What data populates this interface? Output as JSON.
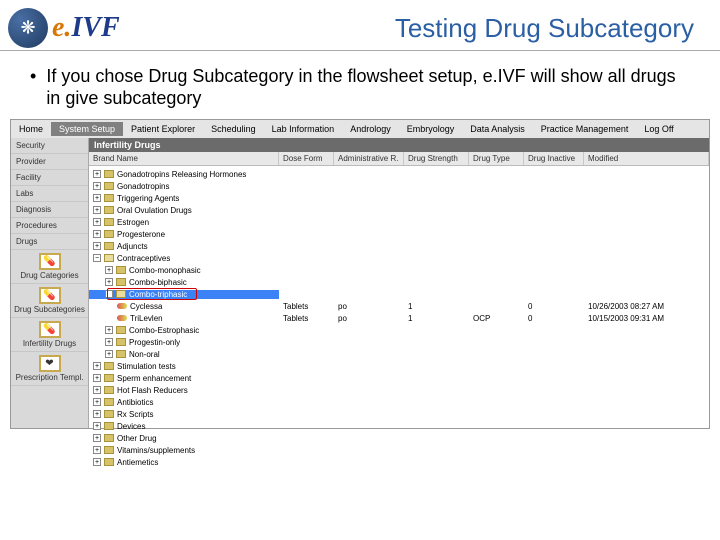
{
  "slide": {
    "title": "Testing Drug Subcategory",
    "logo_e": "e.",
    "logo_ivf": "IVF",
    "bullet": "If you chose Drug Subcategory in the flowsheet setup, e.IVF will show all drugs in give subcategory"
  },
  "menubar": [
    "Home",
    "System Setup",
    "Patient Explorer",
    "Scheduling",
    "Lab Information",
    "Andrology",
    "Embryology",
    "Data Analysis",
    "Practice Management",
    "Log Off"
  ],
  "menubar_active_index": 1,
  "sidebar": {
    "text_items": [
      "Security",
      "Provider",
      "Facility",
      "Labs",
      "Diagnosis",
      "Procedures",
      "Drugs"
    ],
    "icon_items": [
      {
        "glyph": "💊",
        "label": "Drug Categories"
      },
      {
        "glyph": "💊",
        "label": "Drug Subcategories"
      },
      {
        "glyph": "💊",
        "label": "Infertility Drugs"
      },
      {
        "glyph": "❤",
        "label": "Prescription Templ."
      }
    ]
  },
  "grid": {
    "title": "Infertility Drugs",
    "headers": {
      "bn": "Brand Name",
      "df": "Dose Form",
      "ar": "Administrative R.",
      "ds": "Drug Strength",
      "dt": "Drug Type",
      "di": "Drug Inactive",
      "mo": "Modified"
    }
  },
  "tree": {
    "cat_root": [
      "Gonadotropins Releasing Hormones",
      "Gonadotropins",
      "Triggering Agents",
      "Oral Ovulation Drugs",
      "Estrogen",
      "Progesterone",
      "Adjuncts"
    ],
    "contraceptives_label": "Contraceptives",
    "combo_mono": "Combo-monophasic",
    "combo_bi": "Combo-biphasic",
    "combo_tri": "Combo-triphasic",
    "combo_children": [
      {
        "bn": "Cyclessa",
        "df": "Tablets",
        "ar": "po",
        "ds": "1",
        "dt": "",
        "di": "0",
        "mo": "10/26/2003 08:27 AM"
      },
      {
        "bn": "TriLevlen",
        "df": "Tablets",
        "ar": "po",
        "ds": "1",
        "dt": "OCP",
        "di": "0",
        "mo": "10/15/2003 09:31 AM"
      }
    ],
    "combo_estro": "Combo-Estrophasic",
    "cat_tail": [
      "Progestin-only",
      "Non-oral",
      "Stimulation tests",
      "Sperm enhancement",
      "Hot Flash Reducers",
      "Antibiotics",
      "Rx Scripts",
      "Devices",
      "Other Drug",
      "Vitamins/supplements",
      "Antiemetics"
    ]
  }
}
